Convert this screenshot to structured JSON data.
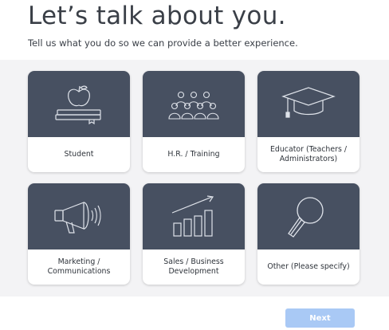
{
  "header": {
    "title": "Let’s talk about you.",
    "subtitle": "Tell us what you do so we can provide a better experience."
  },
  "options": [
    {
      "label": "Student",
      "icon": "apple-on-books-icon"
    },
    {
      "label": "H.R. / Training",
      "icon": "audience-people-icon"
    },
    {
      "label": "Educator (Teachers / Administrators)",
      "icon": "graduation-cap-icon"
    },
    {
      "label": "Marketing / Communications",
      "icon": "megaphone-icon"
    },
    {
      "label": "Sales / Business Development",
      "icon": "growth-bar-chart-icon"
    },
    {
      "label": "Other (Please specify)",
      "icon": "magnifying-glass-icon"
    }
  ],
  "actions": {
    "next_label": "Next"
  },
  "colors": {
    "card_art": "#475061",
    "panel": "#f3f3f5",
    "next_button": "#a9c9f5"
  }
}
